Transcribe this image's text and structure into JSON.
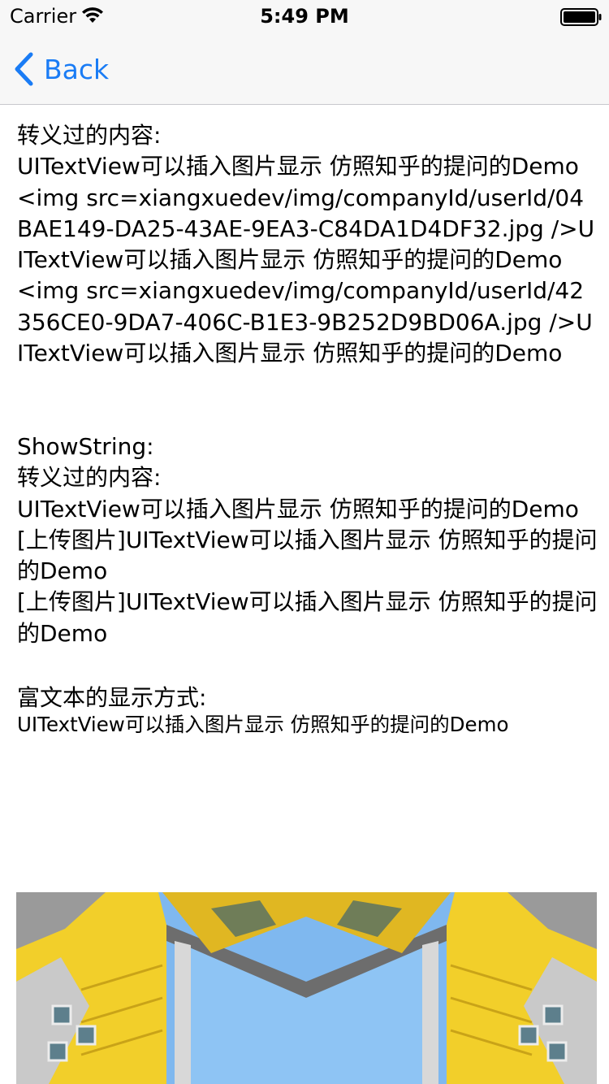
{
  "status_bar": {
    "carrier": "Carrier",
    "time": "5:49 PM"
  },
  "nav": {
    "back_label": "Back",
    "accent_color": "#1a7cf5"
  },
  "content": {
    "escaped_text": "转义过的内容:\nUITextView可以插入图片显示 仿照知乎的提问的Demo\n<img src=xiangxuedev/img/companyId/userId/04BAE149-DA25-43AE-9EA3-C84DA1D4DF32.jpg />UITextView可以插入图片显示 仿照知乎的提问的Demo\n<img src=xiangxuedev/img/companyId/userId/42356CE0-9DA7-406C-B1E3-9B252D9BD06A.jpg />UITextView可以插入图片显示 仿照知乎的提问的Demo\n\n\n",
    "show_string_text": "ShowString:\n转义过的内容:\nUITextView可以插入图片显示 仿照知乎的提问的Demo\n[上传图片]UITextView可以插入图片显示 仿照知乎的提问的Demo\n[上传图片]UITextView可以插入图片显示 仿照知乎的提问的Demo",
    "rich_title": "富文本的显示方式:",
    "rich_line": "UITextView可以插入图片显示 仿照知乎的提问的Demo"
  },
  "image": {
    "name": "building-photo"
  }
}
